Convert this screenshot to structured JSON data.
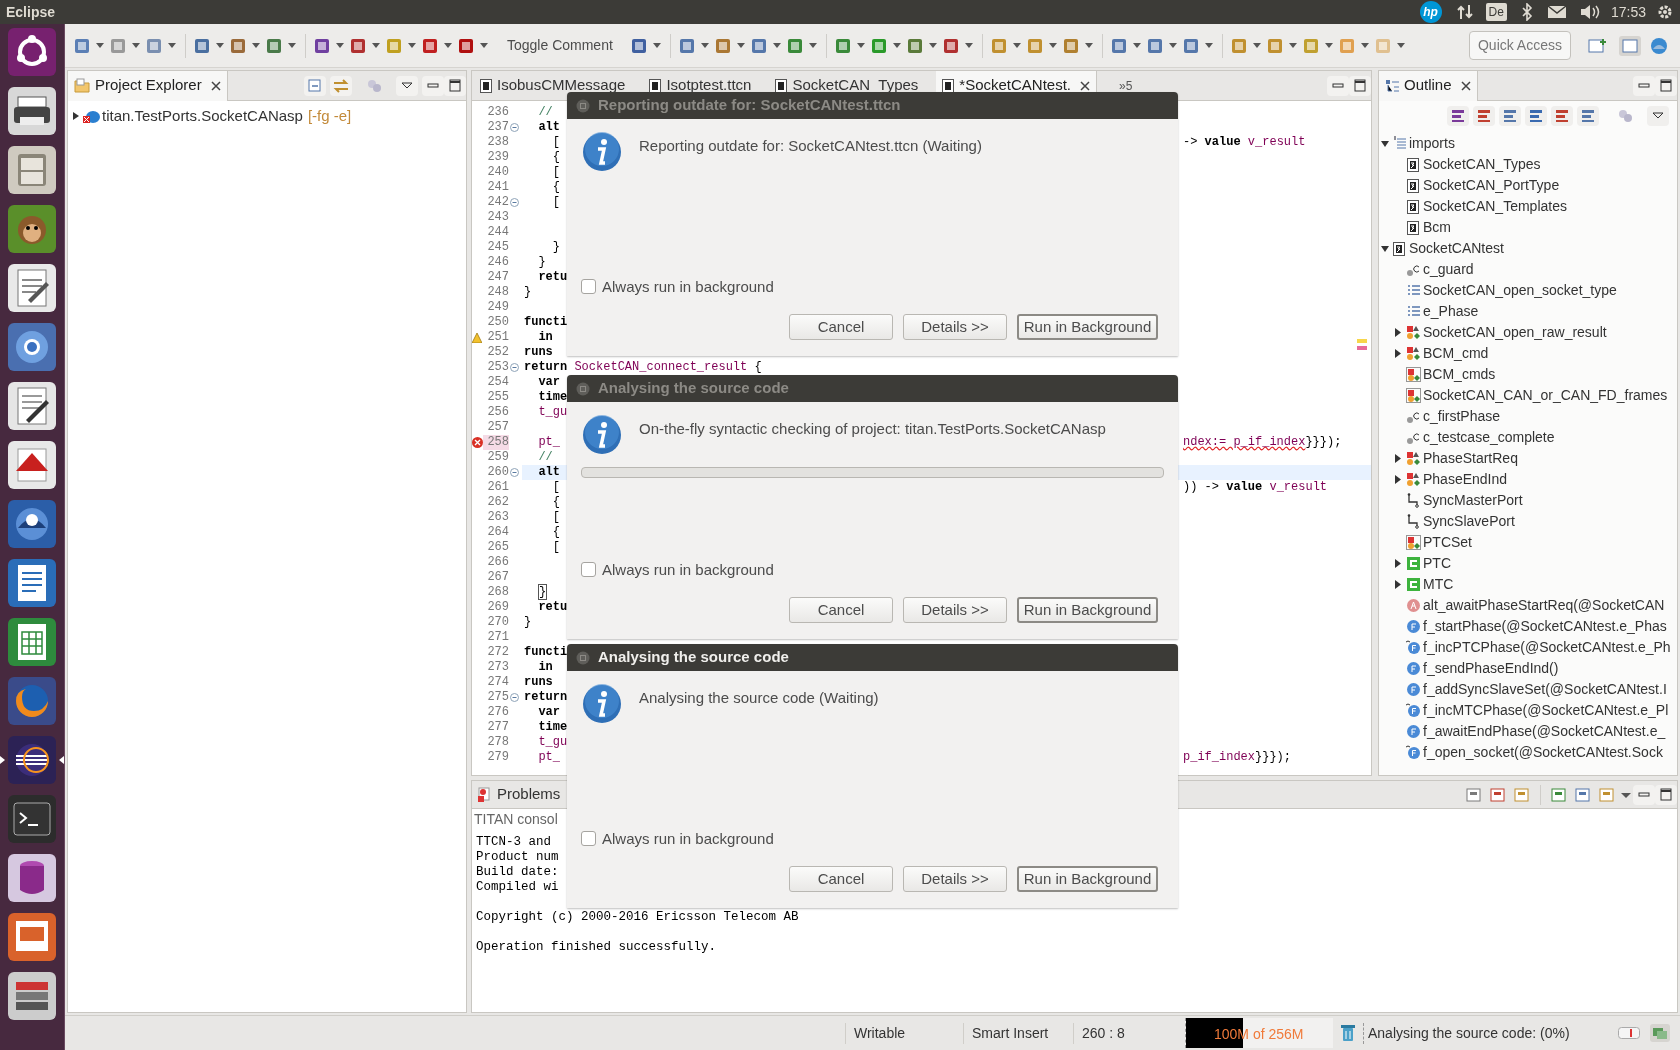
{
  "top_bar": {
    "title": "Eclipse",
    "logo": "hp",
    "keyboard": "De",
    "clock": "17:53"
  },
  "launcher": [
    {
      "kind": "ubuntu",
      "active": false
    },
    {
      "kind": "printer",
      "active": false
    },
    {
      "kind": "cabinet",
      "active": false
    },
    {
      "kind": "monkey",
      "active": false
    },
    {
      "kind": "notepad",
      "active": false
    },
    {
      "kind": "chromium",
      "active": false
    },
    {
      "kind": "pencil",
      "active": false
    },
    {
      "kind": "pdf",
      "active": false
    },
    {
      "kind": "mail",
      "active": false
    },
    {
      "kind": "writer",
      "active": false
    },
    {
      "kind": "calc",
      "active": false
    },
    {
      "kind": "firefox",
      "active": false
    },
    {
      "kind": "eclipse",
      "active": true
    },
    {
      "kind": "terminal",
      "active": false
    },
    {
      "kind": "database",
      "active": false
    },
    {
      "kind": "impress",
      "active": false
    },
    {
      "kind": "stack",
      "active": false
    }
  ],
  "toolbar": {
    "toggle_comment": "Toggle Comment",
    "quick_access": "Quick Access"
  },
  "project_explorer": {
    "tab": "Project Explorer",
    "items": [
      {
        "label": "titan.TestPorts.SocketCANasp",
        "flags": "[-fg -e]",
        "expanded": false
      }
    ]
  },
  "editor": {
    "tabs": [
      {
        "label": "IsobusCMMessage",
        "selected": false
      },
      {
        "label": "Isotptest.ttcn",
        "selected": false
      },
      {
        "label": "SocketCAN_Types",
        "selected": false
      },
      {
        "label": "*SocketCANtest.",
        "selected": true
      }
    ],
    "overflow": "»5",
    "lines": [
      {
        "number": "236",
        "code": [
          {
            "kind": "comment",
            "text": "  //"
          }
        ]
      },
      {
        "number": "237",
        "fold": true,
        "code": [
          {
            "kind": "keyword",
            "text": "  alt"
          }
        ]
      },
      {
        "number": "238",
        "code": [
          {
            "kind": "plain",
            "text": "    ["
          }
        ],
        "tail": [
          {
            "kind": "plain",
            "text": "-> "
          },
          {
            "kind": "keyword",
            "text": "value"
          },
          {
            "kind": "ident",
            "text": " v_result"
          }
        ]
      },
      {
        "number": "239",
        "code": [
          {
            "kind": "plain",
            "text": "    {"
          }
        ]
      },
      {
        "number": "240",
        "code": [
          {
            "kind": "plain",
            "text": "    ["
          }
        ]
      },
      {
        "number": "241",
        "code": [
          {
            "kind": "plain",
            "text": "    {"
          }
        ]
      },
      {
        "number": "242",
        "fold": true,
        "code": [
          {
            "kind": "plain",
            "text": "    ["
          }
        ]
      },
      {
        "number": "243"
      },
      {
        "number": "244"
      },
      {
        "number": "245",
        "code": [
          {
            "kind": "plain",
            "text": "    }"
          }
        ]
      },
      {
        "number": "246",
        "code": [
          {
            "kind": "plain",
            "text": "  }"
          }
        ]
      },
      {
        "number": "247",
        "code": [
          {
            "kind": "keyword",
            "text": "  retu"
          }
        ]
      },
      {
        "number": "248",
        "code": [
          {
            "kind": "plain",
            "text": "}"
          }
        ]
      },
      {
        "number": "249"
      },
      {
        "number": "250",
        "code": [
          {
            "kind": "keyword",
            "text": "functi"
          }
        ]
      },
      {
        "number": "251",
        "warning": true,
        "code": [
          {
            "kind": "keyword",
            "text": "  in"
          }
        ]
      },
      {
        "number": "252",
        "code": [
          {
            "kind": "keyword",
            "text": "runs"
          }
        ]
      },
      {
        "number": "253",
        "fold": true,
        "code": [
          {
            "kind": "keyword",
            "text": "return"
          },
          {
            "kind": "ident",
            "text": " SocketCAN_connect_result"
          },
          {
            "kind": "plain",
            "text": " {"
          }
        ]
      },
      {
        "number": "254",
        "code": [
          {
            "kind": "keyword",
            "text": "  var"
          }
        ]
      },
      {
        "number": "255",
        "code": [
          {
            "kind": "keyword",
            "text": "  time"
          }
        ]
      },
      {
        "number": "256",
        "code": [
          {
            "kind": "ident",
            "text": "  t_gu"
          }
        ]
      },
      {
        "number": "257"
      },
      {
        "number": "258",
        "error": true,
        "code": [
          {
            "kind": "ident",
            "text": "  pt_"
          }
        ],
        "tail": [
          {
            "kind": "error",
            "text": "ndex:= p_if_index"
          },
          {
            "kind": "plain",
            "text": "}}});"
          }
        ]
      },
      {
        "number": "259",
        "code": [
          {
            "kind": "comment",
            "text": "  //"
          }
        ]
      },
      {
        "number": "260",
        "fold": true,
        "current": true,
        "code": [
          {
            "kind": "keyword",
            "text": "  alt"
          }
        ]
      },
      {
        "number": "261",
        "code": [
          {
            "kind": "plain",
            "text": "    ["
          }
        ],
        "tail": [
          {
            "kind": "plain",
            "text": ")) -> "
          },
          {
            "kind": "keyword",
            "text": "value"
          },
          {
            "kind": "ident",
            "text": " v_result"
          }
        ]
      },
      {
        "number": "262",
        "code": [
          {
            "kind": "plain",
            "text": "    {"
          }
        ]
      },
      {
        "number": "263",
        "code": [
          {
            "kind": "plain",
            "text": "    ["
          }
        ]
      },
      {
        "number": "264",
        "code": [
          {
            "kind": "plain",
            "text": "    {"
          }
        ]
      },
      {
        "number": "265",
        "code": [
          {
            "kind": "plain",
            "text": "    ["
          }
        ]
      },
      {
        "number": "266"
      },
      {
        "number": "267"
      },
      {
        "number": "268",
        "code": [
          {
            "kind": "match",
            "text": "}"
          }
        ]
      },
      {
        "number": "269",
        "code": [
          {
            "kind": "keyword",
            "text": "  retu"
          }
        ]
      },
      {
        "number": "270",
        "code": [
          {
            "kind": "plain",
            "text": "}"
          }
        ]
      },
      {
        "number": "271"
      },
      {
        "number": "272",
        "code": [
          {
            "kind": "keyword",
            "text": "functi"
          }
        ]
      },
      {
        "number": "273",
        "code": [
          {
            "kind": "keyword",
            "text": "  in"
          }
        ]
      },
      {
        "number": "274",
        "code": [
          {
            "kind": "keyword",
            "text": "runs"
          }
        ]
      },
      {
        "number": "275",
        "fold": true,
        "code": [
          {
            "kind": "keyword",
            "text": "return"
          }
        ]
      },
      {
        "number": "276",
        "code": [
          {
            "kind": "keyword",
            "text": "  var"
          }
        ]
      },
      {
        "number": "277",
        "code": [
          {
            "kind": "keyword",
            "text": "  time"
          }
        ]
      },
      {
        "number": "278",
        "code": [
          {
            "kind": "ident",
            "text": "  t_gu"
          }
        ]
      },
      {
        "number": "279",
        "code": [
          {
            "kind": "ident",
            "text": "  pt_"
          }
        ],
        "tail": [
          {
            "kind": "ident",
            "text": "p_if_index"
          },
          {
            "kind": "plain",
            "text": "}}});"
          }
        ]
      }
    ]
  },
  "outline": {
    "tab": "Outline",
    "items": [
      {
        "label": "imports",
        "kind": "imports",
        "expanded": true,
        "children": [
          {
            "label": "SocketCAN_Types",
            "kind": "module"
          },
          {
            "label": "SocketCAN_PortType",
            "kind": "module"
          },
          {
            "label": "SocketCAN_Templates",
            "kind": "module"
          },
          {
            "label": "Bcm",
            "kind": "module"
          }
        ]
      },
      {
        "label": "SocketCANtest",
        "kind": "module",
        "expanded": true,
        "children": [
          {
            "label": "c_guard",
            "kind": "constant"
          },
          {
            "label": "SocketCAN_open_socket_type",
            "kind": "enum"
          },
          {
            "label": "e_Phase",
            "kind": "enum"
          },
          {
            "label": "SocketCAN_open_raw_result",
            "kind": "record",
            "expanded": false
          },
          {
            "label": "BCM_cmd",
            "kind": "record",
            "expanded": false
          },
          {
            "label": "BCM_cmds",
            "kind": "setof"
          },
          {
            "label": "SocketCAN_CAN_or_CAN_FD_frames",
            "kind": "setof"
          },
          {
            "label": "c_firstPhase",
            "kind": "constant"
          },
          {
            "label": "c_testcase_complete",
            "kind": "constant"
          },
          {
            "label": "PhaseStartReq",
            "kind": "record",
            "expanded": false
          },
          {
            "label": "PhaseEndInd",
            "kind": "record",
            "expanded": false
          },
          {
            "label": "SyncMasterPort",
            "kind": "port"
          },
          {
            "label": "SyncSlavePort",
            "kind": "port"
          },
          {
            "label": "PTCSet",
            "kind": "setof"
          },
          {
            "label": "PTC",
            "kind": "component",
            "expanded": false
          },
          {
            "label": "MTC",
            "kind": "component",
            "expanded": false
          },
          {
            "label": "alt_awaitPhaseStartReq(@SocketCAN",
            "kind": "altstep"
          },
          {
            "label": "f_startPhase(@SocketCANtest.e_Phas",
            "kind": "function"
          },
          {
            "label": "f_incPTCPhase(@SocketCANtest.e_Ph",
            "kind": "function-runs"
          },
          {
            "label": "f_sendPhaseEndInd()",
            "kind": "function"
          },
          {
            "label": "f_addSyncSlaveSet(@SocketCANtest.I",
            "kind": "function"
          },
          {
            "label": "f_incMTCPhase(@SocketCANtest.e_Pl",
            "kind": "function-runs"
          },
          {
            "label": "f_awaitEndPhase(@SocketCANtest.e_",
            "kind": "function"
          },
          {
            "label": "f_open_socket(@SocketCANtest.Sock",
            "kind": "function-runs"
          }
        ]
      }
    ]
  },
  "problems": {
    "tab": "Problems",
    "console_title": "TITAN consol",
    "console_blocks": [
      [
        "TTCN-3 and",
        "Product num",
        "Build date:",
        "Compiled wi"
      ],
      [
        "Copyright (c) 2000-2016 Ericsson Telecom AB"
      ],
      [
        "Operation finished successfully."
      ]
    ]
  },
  "dialogs": [
    {
      "title": "Reporting outdate for: SocketCANtest.ttcn",
      "active": false,
      "message": "Reporting outdate for: SocketCANtest.ttcn (Waiting)",
      "checkbox": {
        "label": "Always run in background",
        "checked": false
      },
      "buttons": [
        "Cancel",
        "Details >>",
        "Run in Background"
      ]
    },
    {
      "title": "Analysing the source code",
      "active": false,
      "message": "On-the-fly syntactic checking of project: titan.TestPorts.SocketCANasp",
      "progress": {
        "level": 0
      },
      "checkbox": {
        "label": "Always run in background",
        "checked": false
      },
      "buttons": [
        "Cancel",
        "Details >>",
        "Run in Background"
      ]
    },
    {
      "title": "Analysing the source code",
      "active": true,
      "message": "Analysing the source code (Waiting)",
      "checkbox": {
        "label": "Always run in background",
        "checked": false
      },
      "buttons": [
        "Cancel",
        "Details >>",
        "Run in Background"
      ]
    }
  ],
  "status_bar": {
    "mode": "Writable",
    "insert": "Smart Insert",
    "position": "260 : 8",
    "memory": {
      "text": "100M of 256M",
      "level": 0.39
    },
    "task": "Analysing the source code: (0%)"
  }
}
